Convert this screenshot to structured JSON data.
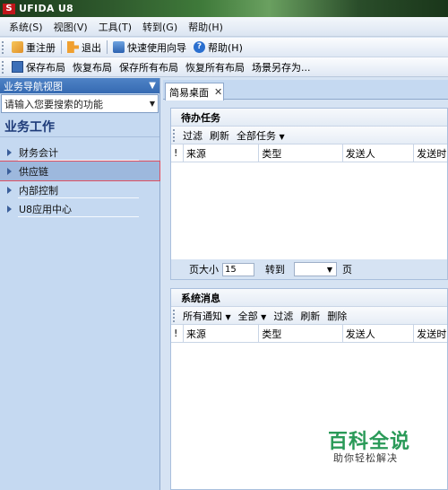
{
  "app": {
    "title": "UFIDA U8",
    "logo_text": "S"
  },
  "menu": [
    "系统(S)",
    "视图(V)",
    "工具(T)",
    "转到(G)",
    "帮助(H)"
  ],
  "toolbar1": {
    "register": "重注册",
    "exit": "退出",
    "wizard": "快速使用向导",
    "help": "帮助(H)"
  },
  "toolbar2": {
    "save_layout": "保存布局",
    "restore_layout": "恢复布局",
    "save_all_layout": "保存所有布局",
    "restore_all_layout": "恢复所有布局",
    "save_scene_as": "场景另存为..."
  },
  "left_panel": {
    "header": "业务导航视图",
    "search_placeholder": "请输入您要搜索的功能",
    "section": "业务工作",
    "items": [
      {
        "label": "财务会计"
      },
      {
        "label": "供应链"
      },
      {
        "label": "内部控制"
      },
      {
        "label": "U8应用中心"
      }
    ]
  },
  "tab": {
    "label": "简易桌面"
  },
  "todo": {
    "title": "待办任务",
    "tools": {
      "filter": "过滤",
      "refresh": "刷新",
      "all_tasks": "全部任务"
    },
    "columns": [
      "!",
      "来源",
      "类型",
      "发送人",
      "发送时"
    ],
    "pager": {
      "page_size_label": "页大小",
      "page_size": "15",
      "goto_label": "转到",
      "page_label": "页"
    }
  },
  "messages": {
    "title": "系统消息",
    "tools": {
      "all_notices": "所有通知",
      "all": "全部",
      "filter": "过滤",
      "refresh": "刷新",
      "delete": "删除"
    },
    "columns": [
      "!",
      "来源",
      "类型",
      "发送人",
      "发送时"
    ]
  },
  "watermark": {
    "main": "百科全说",
    "sub": "助你轻松解决"
  }
}
